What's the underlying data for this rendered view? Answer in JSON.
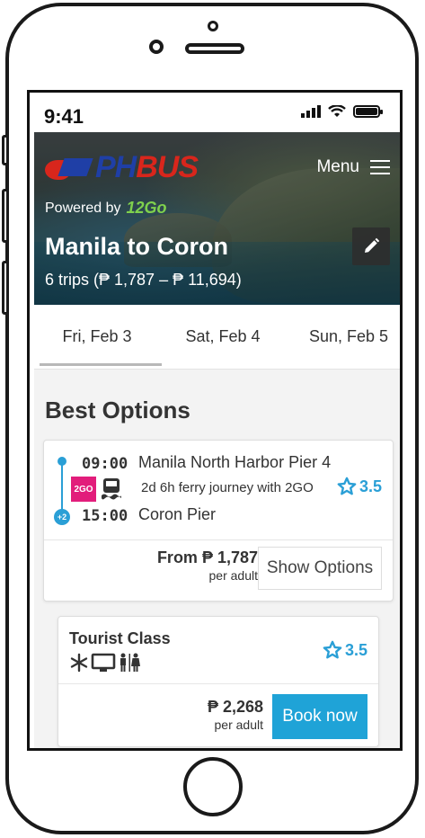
{
  "status_bar": {
    "time": "9:41"
  },
  "header": {
    "menu_label": "Menu",
    "powered_by_label": "Powered by",
    "powered_by_logo_text": "12Go",
    "route_title": "Manila to Coron",
    "route_subtitle": "6 trips (₱ 1,787 – ₱ 11,694)",
    "brand": {
      "text": "PHBUS",
      "colors": {
        "red": "#d8261c",
        "blue": "#1f3fa6"
      }
    }
  },
  "date_tabs": [
    {
      "label": "Fri, Feb 3",
      "active": true
    },
    {
      "label": "Sat, Feb 4",
      "active": false
    },
    {
      "label": "Sun, Feb 5",
      "active": false
    }
  ],
  "section_title": "Best Options",
  "trip": {
    "departure_time": "09:00",
    "departure_place": "Manila North Harbor Pier 4",
    "arrival_time": "15:00",
    "arrival_place": "Coron Pier",
    "day_offset_badge": "+2",
    "operator_logo_text": "2GO",
    "journey_desc": "2d 6h ferry journey with 2GO",
    "rating": "3.5",
    "price_label": "From ₱ 1,787",
    "price_sub": "per adult",
    "show_options_label": "Show Options"
  },
  "class_option": {
    "title": "Tourist Class",
    "amenity_icons": [
      "snowflake-icon",
      "tv-icon",
      "restroom-icon"
    ],
    "rating": "3.5",
    "price": "₱ 2,268",
    "price_sub": "per adult",
    "book_label": "Book now"
  },
  "colors": {
    "accent": "#2a9fd6",
    "book_button": "#1fa3d7",
    "operator": "#e21d7b"
  }
}
